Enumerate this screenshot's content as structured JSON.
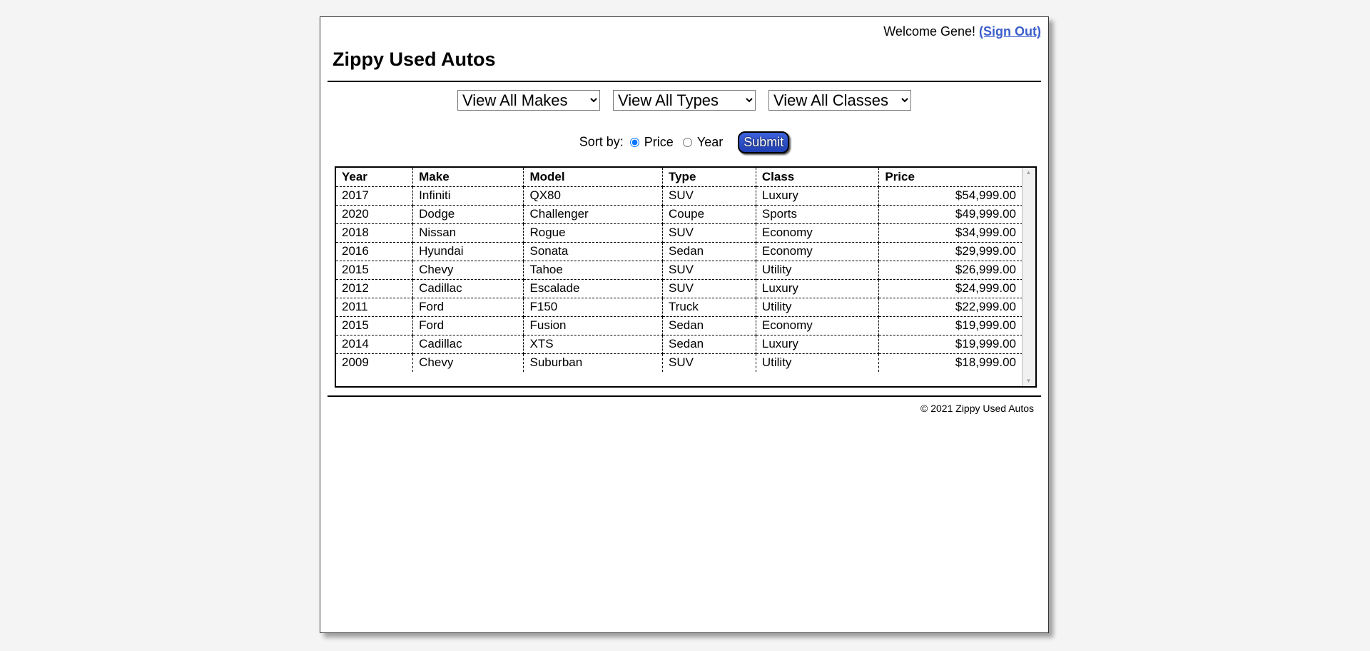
{
  "header": {
    "welcome_text": "Welcome Gene!",
    "sign_out_label": "(Sign Out)",
    "site_title": "Zippy Used Autos"
  },
  "filters": {
    "makes_selected": "View All Makes",
    "types_selected": "View All Types",
    "classes_selected": "View All Classes"
  },
  "sort": {
    "label": "Sort by:",
    "option_price": "Price",
    "option_year": "Year",
    "selected": "Price",
    "submit_label": "Submit"
  },
  "table": {
    "columns": [
      "Year",
      "Make",
      "Model",
      "Type",
      "Class",
      "Price"
    ],
    "rows": [
      [
        "2017",
        "Infiniti",
        "QX80",
        "SUV",
        "Luxury",
        "$54,999.00"
      ],
      [
        "2020",
        "Dodge",
        "Challenger",
        "Coupe",
        "Sports",
        "$49,999.00"
      ],
      [
        "2018",
        "Nissan",
        "Rogue",
        "SUV",
        "Economy",
        "$34,999.00"
      ],
      [
        "2016",
        "Hyundai",
        "Sonata",
        "Sedan",
        "Economy",
        "$29,999.00"
      ],
      [
        "2015",
        "Chevy",
        "Tahoe",
        "SUV",
        "Utility",
        "$26,999.00"
      ],
      [
        "2012",
        "Cadillac",
        "Escalade",
        "SUV",
        "Luxury",
        "$24,999.00"
      ],
      [
        "2011",
        "Ford",
        "F150",
        "Truck",
        "Utility",
        "$22,999.00"
      ],
      [
        "2015",
        "Ford",
        "Fusion",
        "Sedan",
        "Economy",
        "$19,999.00"
      ],
      [
        "2014",
        "Cadillac",
        "XTS",
        "Sedan",
        "Luxury",
        "$19,999.00"
      ],
      [
        "2009",
        "Chevy",
        "Suburban",
        "SUV",
        "Utility",
        "$18,999.00"
      ]
    ]
  },
  "footer": {
    "copyright": "© 2021 Zippy Used Autos"
  },
  "colors": {
    "link": "#3b5ecb",
    "button": "#2a4cc4",
    "background": "#f4f4f4"
  }
}
